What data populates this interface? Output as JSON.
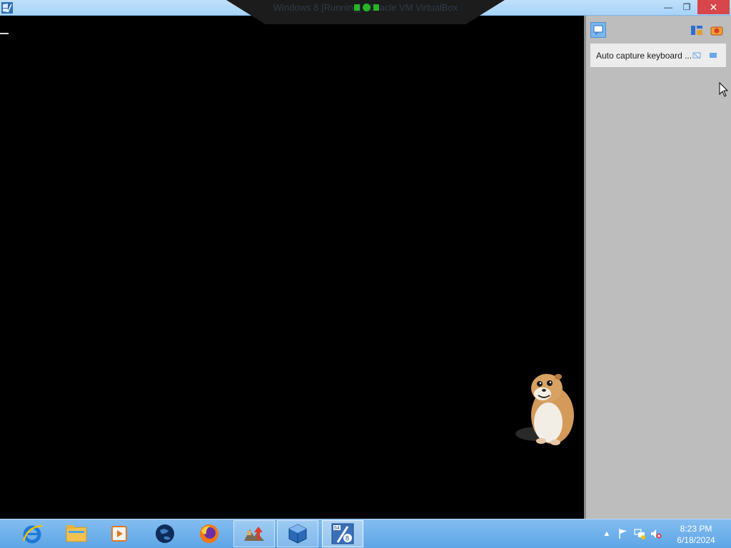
{
  "window": {
    "title": "Windows 8 [Running] - Oracle VM VirtualBox",
    "minimize_glyph": "—",
    "restore_glyph": "❐",
    "close_glyph": "✕",
    "app_icon": "windows-8-vm-icon"
  },
  "notifications": {
    "message": "Auto capture keyboard ...",
    "toggle_icon": "notification-panel-icon",
    "header_icons": [
      "keyboard-capture-icon",
      "mouse-integration-icon"
    ],
    "message_buttons": [
      "dismiss-icon",
      "pin-icon"
    ]
  },
  "taskbar": {
    "apps": [
      {
        "name": "Internet Explorer",
        "icon": "internet-explorer-icon",
        "state": "normal"
      },
      {
        "name": "File Explorer",
        "icon": "file-explorer-icon",
        "state": "normal"
      },
      {
        "name": "Media Player",
        "icon": "media-player-icon",
        "state": "normal"
      },
      {
        "name": "Earth",
        "icon": "globe-icon",
        "state": "normal"
      },
      {
        "name": "Firefox",
        "icon": "firefox-icon",
        "state": "normal"
      },
      {
        "name": "Toolbox",
        "icon": "toolbox-icon",
        "state": "open"
      },
      {
        "name": "VirtualBox",
        "icon": "virtualbox-icon",
        "state": "open"
      },
      {
        "name": "Windows 8 (64-bit)",
        "icon": "vm-windows8-icon",
        "state": "active"
      }
    ],
    "tray": {
      "icons": [
        "show-hidden-icons-arrow",
        "action-center-flag-icon",
        "network-icon",
        "volume-muted-icon"
      ],
      "time": "8:23 PM",
      "date": "6/18/2024"
    }
  },
  "colors": {
    "titlebar": "#a7d3f8",
    "close_button": "#d8454a",
    "taskbar": "#6aaeea",
    "side_panel": "#bdbdbd"
  }
}
